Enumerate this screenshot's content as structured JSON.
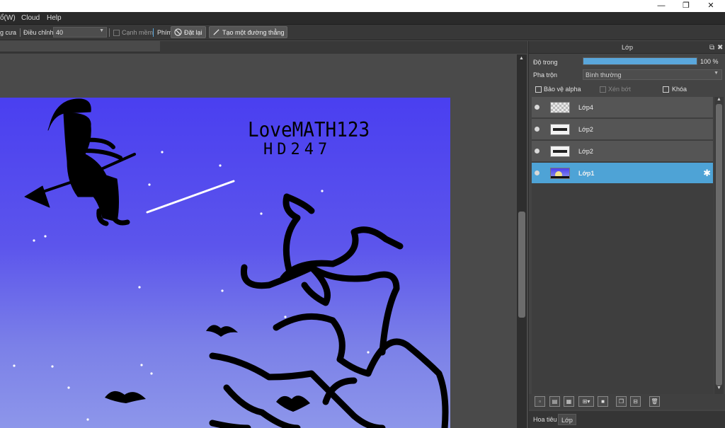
{
  "window": {
    "minimize": "—",
    "maximize": "❐",
    "close": "✕"
  },
  "menu": {
    "items": [
      "ổ(W)",
      "Cloud",
      "Help"
    ]
  },
  "toolbar": {
    "antialias_label": "g cưa",
    "adjust_label": "Điều chỉnh",
    "adjust_value": "40",
    "soft_edge_label": "Cạnh mềm",
    "key_label": "Phím",
    "reset_label": "Đặt lại",
    "straight_line_label": "Tạo một đường thẳng"
  },
  "artwork": {
    "handwriting_line1": "LoveMATH123",
    "handwriting_line2": "HD247"
  },
  "layer_panel": {
    "title": "Lớp",
    "opacity_label": "Độ trong",
    "opacity_value": "100 %",
    "opacity_fraction": 1.0,
    "blend_label": "Pha trộn",
    "blend_value": "Bình thường",
    "protect_alpha_label": "Bảo vệ alpha",
    "clipping_label": "Xén bớt",
    "lock_label": "Khóa",
    "layers": [
      {
        "name": "Lớp4",
        "active": false
      },
      {
        "name": "Lớp2",
        "active": false
      },
      {
        "name": "Lớp2",
        "active": false
      },
      {
        "name": "Lớp1",
        "active": true
      }
    ],
    "tabs": [
      "Hoa tiêu",
      "Lớp"
    ]
  },
  "colors": {
    "accent": "#4ea3d6",
    "opacity_fill": "#5aa7dc",
    "sky_top": "#4a3ff0",
    "sky_bottom": "#8d96ea"
  }
}
